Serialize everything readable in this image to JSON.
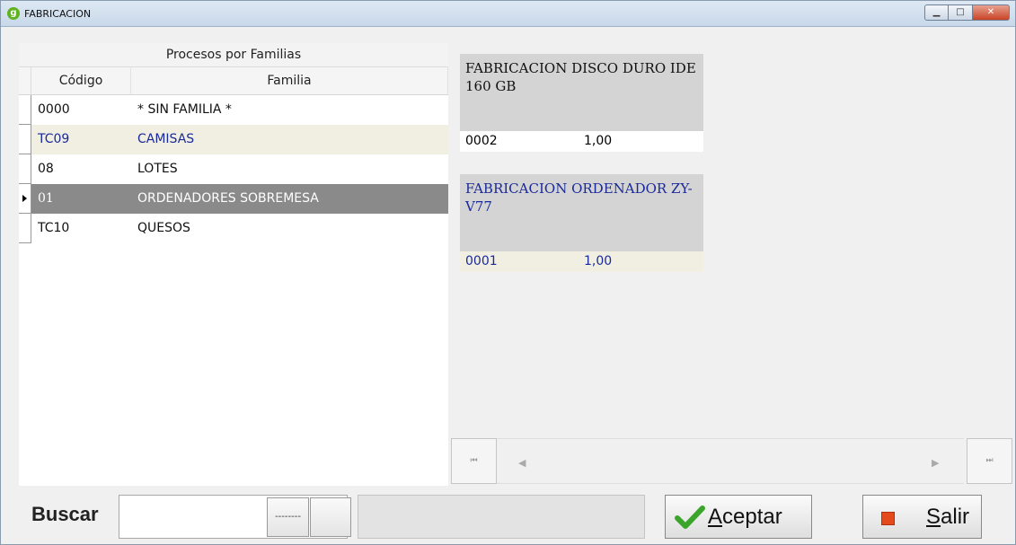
{
  "window": {
    "title": "FABRICACION",
    "icon_letter": "g"
  },
  "left_grid": {
    "band_title": "Procesos por Familias",
    "columns": {
      "code": "Código",
      "family": "Familia"
    },
    "rows": [
      {
        "code": "0000",
        "family": "* SIN FAMILIA *"
      },
      {
        "code": "TC09",
        "family": "CAMISAS"
      },
      {
        "code": "08",
        "family": "LOTES"
      },
      {
        "code": "01",
        "family": "ORDENADORES SOBREMESA"
      },
      {
        "code": "TC10",
        "family": "QUESOS"
      }
    ],
    "selected_index": 3
  },
  "cards": [
    {
      "title": "FABRICACION DISCO DURO IDE 160 GB",
      "code": "0002",
      "qty": "1,00"
    },
    {
      "title": "FABRICACION ORDENADOR ZY-V77",
      "code": "0001",
      "qty": "1,00"
    }
  ],
  "bottom": {
    "search_label": "Buscar",
    "search_value": "",
    "ellipsis_label": "--------",
    "accept_label_first": "A",
    "accept_label_rest": "ceptar",
    "exit_label_first": "S",
    "exit_label_rest": "alir"
  },
  "colors": {
    "selected_row": "#8a8a8a",
    "alt_row": "#f1eee2",
    "alt_text": "#1a2a9a",
    "exit_icon": "#e34b1c",
    "check_icon": "#3aa52a"
  }
}
